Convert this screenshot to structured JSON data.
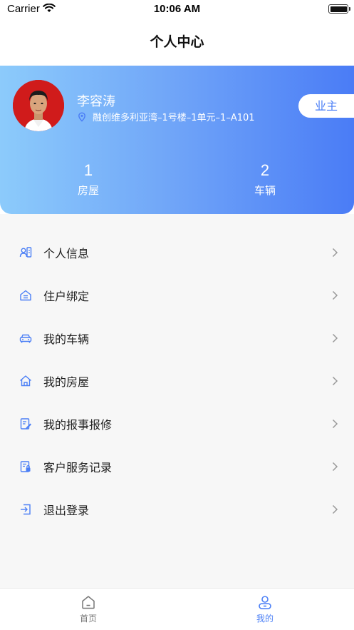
{
  "status_bar": {
    "carrier": "Carrier",
    "time": "10:06 AM"
  },
  "nav": {
    "title": "个人中心"
  },
  "profile": {
    "name": "李容涛",
    "address": "融创维多利亚湾–1号楼–1单元–1–A101",
    "role": "业主",
    "stats": [
      {
        "value": "1",
        "label": "房屋"
      },
      {
        "value": "2",
        "label": "车辆"
      }
    ]
  },
  "menu": [
    {
      "label": "个人信息",
      "icon": "person-id-icon"
    },
    {
      "label": "住户绑定",
      "icon": "home-bind-icon"
    },
    {
      "label": "我的车辆",
      "icon": "car-icon"
    },
    {
      "label": "我的房屋",
      "icon": "house-icon"
    },
    {
      "label": "我的报事报修",
      "icon": "repair-report-icon"
    },
    {
      "label": "客户服务记录",
      "icon": "service-record-icon"
    },
    {
      "label": "退出登录",
      "icon": "logout-icon"
    }
  ],
  "tabbar": {
    "items": [
      {
        "label": "首页",
        "icon": "home-tab-icon"
      },
      {
        "label": "我的",
        "icon": "profile-tab-icon",
        "active": true
      }
    ]
  },
  "colors": {
    "accent": "#4b7ff6",
    "gradient_start": "#8ccbfb",
    "gradient_end": "#4a7cf6",
    "menu_bg": "#f7f7f7"
  }
}
